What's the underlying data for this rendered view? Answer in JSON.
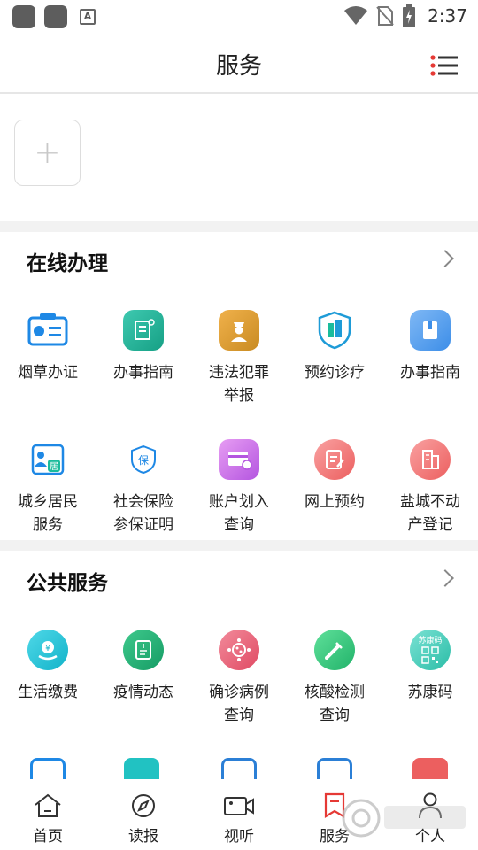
{
  "status_bar": {
    "time": "2:37",
    "app_badge": "A"
  },
  "header": {
    "title": "服务"
  },
  "colors": {
    "brand_red": "#e53935",
    "divider": "#f2f2f2"
  },
  "sections": [
    {
      "title": "在线办理",
      "items": [
        {
          "label": "烟草办证",
          "icon": "tobacco-license-icon"
        },
        {
          "label": "办事指南",
          "icon": "guide-scroll-icon"
        },
        {
          "label": "违法犯罪\n举报",
          "icon": "police-report-icon"
        },
        {
          "label": "预约诊疗",
          "icon": "hospital-shield-icon"
        },
        {
          "label": "办事指南",
          "icon": "guide-book-icon"
        },
        {
          "label": "城乡居民\n服务",
          "icon": "resident-card-icon"
        },
        {
          "label": "社会保险\n参保证明",
          "icon": "insurance-shield-icon"
        },
        {
          "label": "账户划入\n查询",
          "icon": "account-transfer-icon"
        },
        {
          "label": "网上预约",
          "icon": "online-booking-icon"
        },
        {
          "label": "盐城不动\n产登记",
          "icon": "property-building-icon"
        }
      ]
    },
    {
      "title": "公共服务",
      "items": [
        {
          "label": "生活缴费",
          "icon": "bill-payment-icon"
        },
        {
          "label": "疫情动态",
          "icon": "epidemic-news-icon"
        },
        {
          "label": "确诊病例\n查询",
          "icon": "virus-case-icon"
        },
        {
          "label": "核酸检测\n查询",
          "icon": "test-pipette-icon"
        },
        {
          "label": "苏康码",
          "icon": "health-qr-icon",
          "badge": "苏康码"
        }
      ]
    }
  ],
  "add_card": {
    "symbol": "+"
  },
  "bottom_nav": [
    {
      "label": "首页",
      "icon": "home-icon"
    },
    {
      "label": "读报",
      "icon": "compass-icon"
    },
    {
      "label": "视听",
      "icon": "video-camera-icon"
    },
    {
      "label": "服务",
      "icon": "service-bookmark-icon",
      "active": true
    },
    {
      "label": "个人",
      "icon": "person-icon"
    }
  ]
}
